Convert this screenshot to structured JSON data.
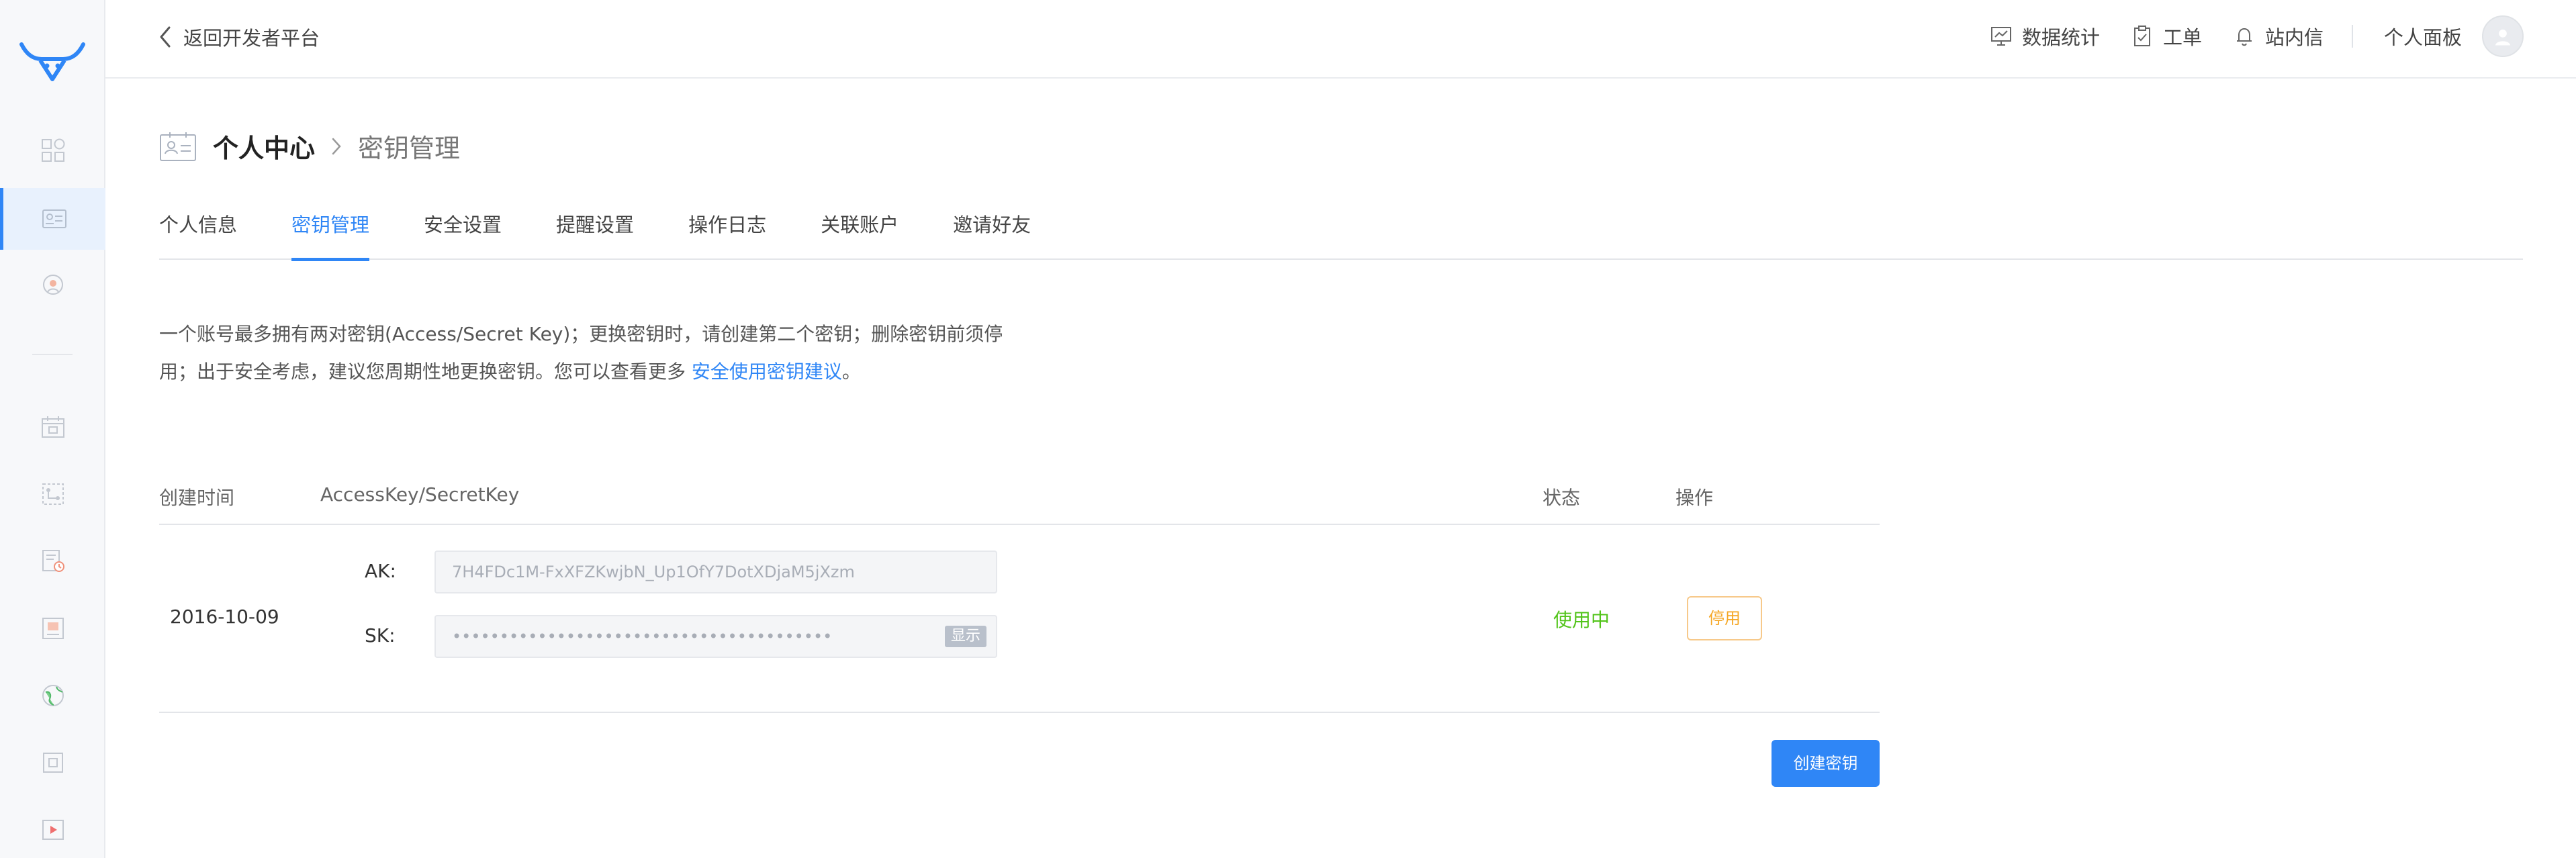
{
  "header": {
    "back_label": "返回开发者平台",
    "items": [
      {
        "label": "数据统计",
        "icon": "chart-icon"
      },
      {
        "label": "工单",
        "icon": "clipboard-icon"
      },
      {
        "label": "站内信",
        "icon": "bell-icon"
      }
    ],
    "user_panel_label": "个人面板"
  },
  "page": {
    "title": "个人中心",
    "subtitle": "密钥管理"
  },
  "tabs": [
    "个人信息",
    "密钥管理",
    "安全设置",
    "提醒设置",
    "操作日志",
    "关联账户",
    "邀请好友"
  ],
  "active_tab": "密钥管理",
  "description": {
    "line1": "一个账号最多拥有两对密钥(Access/Secret Key)；更换密钥时，请创建第二个密钥；删除密钥前须停",
    "line2": "用；出于安全考虑，建议您周期性地更换密钥。您可以查看更多 ",
    "link": "安全使用密钥建议",
    "line2_end": "。"
  },
  "table": {
    "headers": {
      "created": "创建时间",
      "keys": "AccessKey/SecretKey",
      "status": "状态",
      "actions": "操作"
    },
    "rows": [
      {
        "created": "2016-10-09",
        "ak_label": "AK:",
        "ak_value": "7H4FDc1M-FxXFZKwjbN_Up1OfY7DotXDjaM5jXzm",
        "sk_label": "SK:",
        "sk_value": "••••••••••••••••••••••••••••••••••••••••",
        "show_label": "显示",
        "status": "使用中",
        "action": "停用"
      }
    ]
  },
  "create_button": "创建密钥",
  "colors": {
    "accent": "#2f86f6",
    "status_active": "#52c41a",
    "warning": "#f5a623"
  }
}
